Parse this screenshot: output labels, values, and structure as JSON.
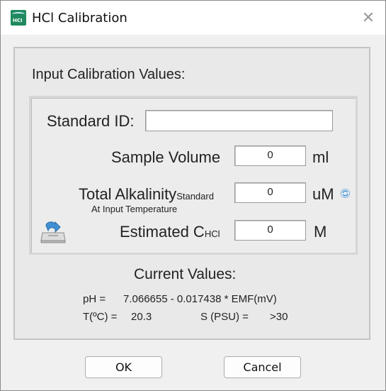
{
  "window": {
    "title": "HCl Calibration",
    "icon": "hci-app-icon",
    "icon_text": "HCI",
    "close_glyph": "✕"
  },
  "panel": {
    "heading": "Input Calibration Values:"
  },
  "form": {
    "standard_id_label": "Standard ID:",
    "standard_id_value": "",
    "sample_volume_label": "Sample Volume",
    "sample_volume_value": "0",
    "sample_volume_unit": "ml",
    "total_alkalinity_label": "Total Alkalinity",
    "total_alkalinity_sub": "Standard",
    "total_alkalinity_note": "At Input Temperature",
    "total_alkalinity_value": "0",
    "total_alkalinity_unit": "uM",
    "estimated_label": "Estimated C",
    "estimated_sub": "HCl",
    "estimated_value": "0",
    "estimated_unit": "M"
  },
  "current": {
    "heading": "Current Values:",
    "ph_label": "pH =",
    "ph_formula": "7.066655 - 0.017438 * EMF(mV)",
    "temp_label": "T(ºC) =",
    "temp_value": "20.3",
    "salinity_label": "S (PSU) =",
    "salinity_value": ">30"
  },
  "buttons": {
    "ok": "OK",
    "cancel": "Cancel"
  },
  "colors": {
    "app_icon": "#1f8a5f",
    "panel_bg": "#e9e9e9",
    "icon_blue": "#3f8fd2"
  }
}
